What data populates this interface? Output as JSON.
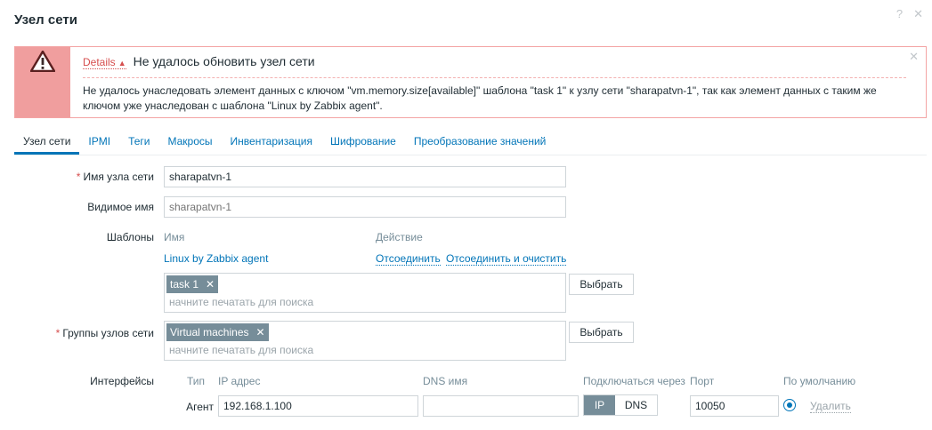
{
  "dialog": {
    "title": "Узел сети",
    "help_icon": "?",
    "close_icon": "✕"
  },
  "message": {
    "details_label": "Details",
    "title": "Не удалось обновить узел сети",
    "body": "Не удалось унаследовать элемент данных с ключом \"vm.memory.size[available]\" шаблона \"task 1\" к узлу сети \"sharapatvn-1\", так как элемент данных с таким же ключом уже унаследован с шаблона \"Linux by Zabbix agent\".",
    "close_icon": "✕",
    "colors": {
      "side": "#f09e9e",
      "border": "#f3a4a4"
    }
  },
  "tabs": [
    {
      "label": "Узел сети",
      "active": true
    },
    {
      "label": "IPMI"
    },
    {
      "label": "Теги"
    },
    {
      "label": "Макросы"
    },
    {
      "label": "Инвентаризация"
    },
    {
      "label": "Шифрование"
    },
    {
      "label": "Преобразование значений"
    }
  ],
  "form": {
    "host_name": {
      "label": "Имя узла сети",
      "value": "sharapatvn-1"
    },
    "visible_name": {
      "label": "Видимое имя",
      "placeholder": "sharapatvn-1"
    },
    "templates": {
      "label": "Шаблоны",
      "col_name": "Имя",
      "col_action": "Действие",
      "linked": [
        {
          "name": "Linux by Zabbix agent",
          "unlink": "Отсоединить",
          "unlink_clear": "Отсоединить и очистить"
        }
      ],
      "selected_chip": "task 1",
      "search_placeholder": "начните печатать для поиска",
      "select_button": "Выбрать"
    },
    "groups": {
      "label": "Группы узлов сети",
      "selected_chip": "Virtual machines",
      "search_placeholder": "начните печатать для поиска",
      "select_button": "Выбрать"
    },
    "interfaces": {
      "label": "Интерфейсы",
      "col_type": "Тип",
      "col_ip": "IP адрес",
      "col_dns": "DNS имя",
      "col_connect": "Подключаться через",
      "col_port": "Порт",
      "col_default": "По умолчанию",
      "rows": [
        {
          "type": "Агент",
          "ip": "192.168.1.100",
          "dns": "",
          "connect_ip": "IP",
          "connect_dns": "DNS",
          "connect_selected": "IP",
          "port": "10050",
          "default": true,
          "remove": "Удалить"
        }
      ]
    }
  },
  "colors": {
    "accent": "#0275b8",
    "chip": "#768d99",
    "error": "#d64e4e"
  }
}
